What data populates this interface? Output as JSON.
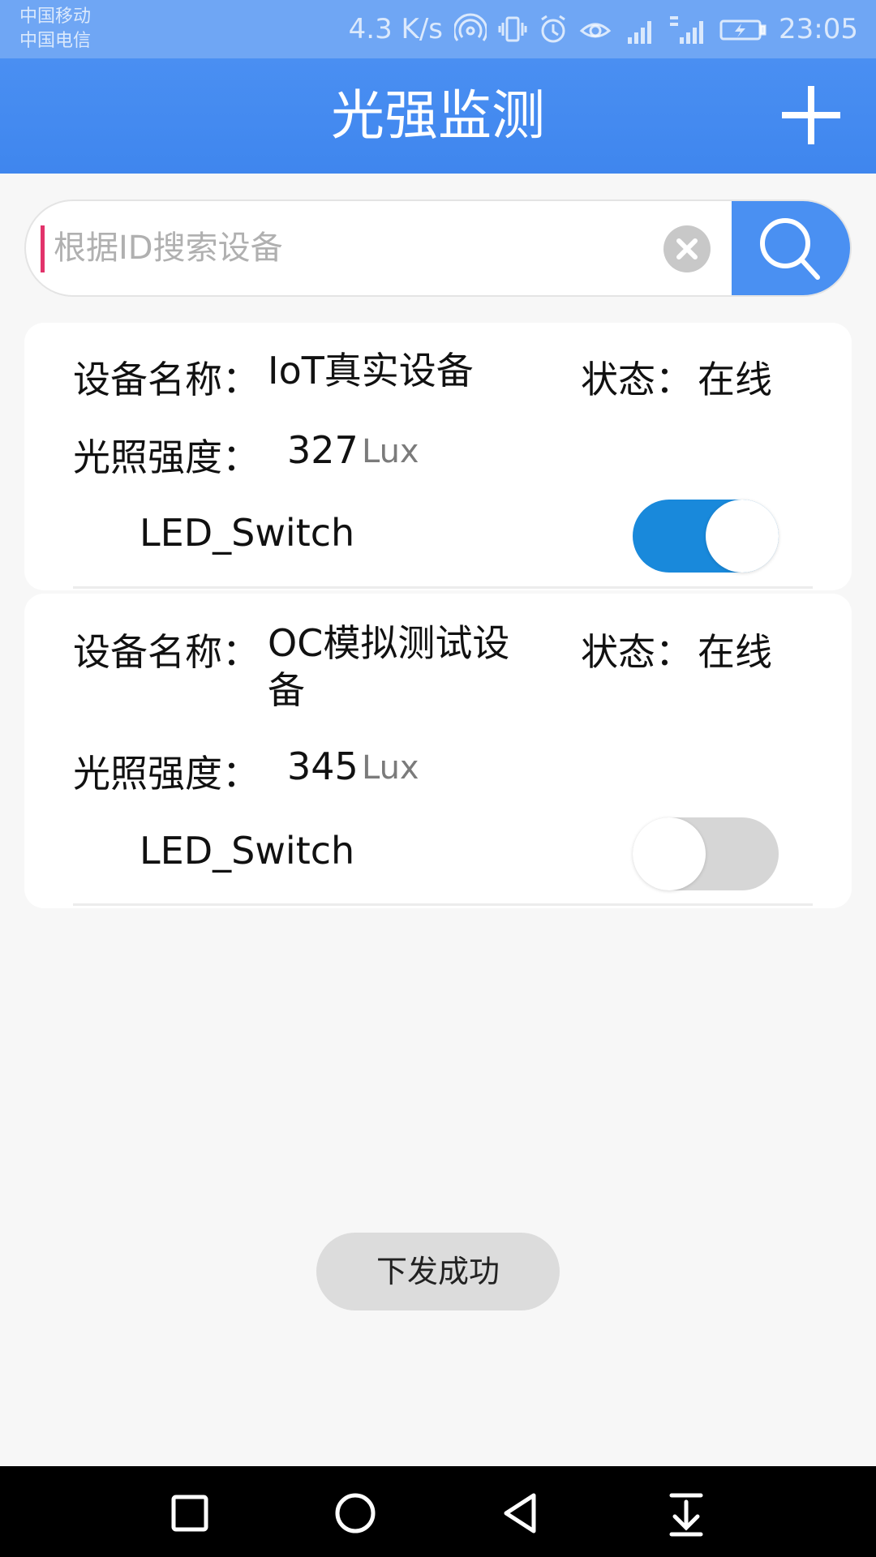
{
  "status_bar": {
    "carrier_1": "中国移动",
    "carrier_2": "中国电信",
    "net_speed": "4.3 K/s",
    "time": "23:05",
    "icons": [
      "hotspot-icon",
      "vibrate-icon",
      "alarm-icon",
      "eye-icon",
      "signal-2g-icon",
      "signal-4g-2g-icon",
      "battery-charging-icon"
    ]
  },
  "app_bar": {
    "title": "光强监测",
    "add_icon": "plus-icon"
  },
  "search": {
    "placeholder": "根据ID搜索设备",
    "value": "",
    "clear_icon": "clear-icon",
    "search_icon": "search-icon"
  },
  "devices": [
    {
      "name_label": "设备名称：",
      "name": "IoT真实设备",
      "status_label": "状态：",
      "status": "在线",
      "lux_label": "光照强度：",
      "lux": "327",
      "lux_unit": "Lux",
      "switch_label": "LED_Switch",
      "switch_on": true
    },
    {
      "name_label": "设备名称：",
      "name": "OC模拟测试设备",
      "status_label": "状态：",
      "status": "在线",
      "lux_label": "光照强度：",
      "lux": "345",
      "lux_unit": "Lux",
      "switch_label": "LED_Switch",
      "switch_on": false
    }
  ],
  "toast": {
    "message": "下发成功"
  },
  "nav_bar": {
    "icons": [
      "recent-apps-icon",
      "home-icon",
      "back-icon",
      "notification-pull-icon"
    ]
  },
  "colors": {
    "app_bar": "#4a8ff2",
    "toggle_on": "#1989db",
    "toggle_off": "#d6d6d6",
    "cursor": "#e2336b"
  }
}
